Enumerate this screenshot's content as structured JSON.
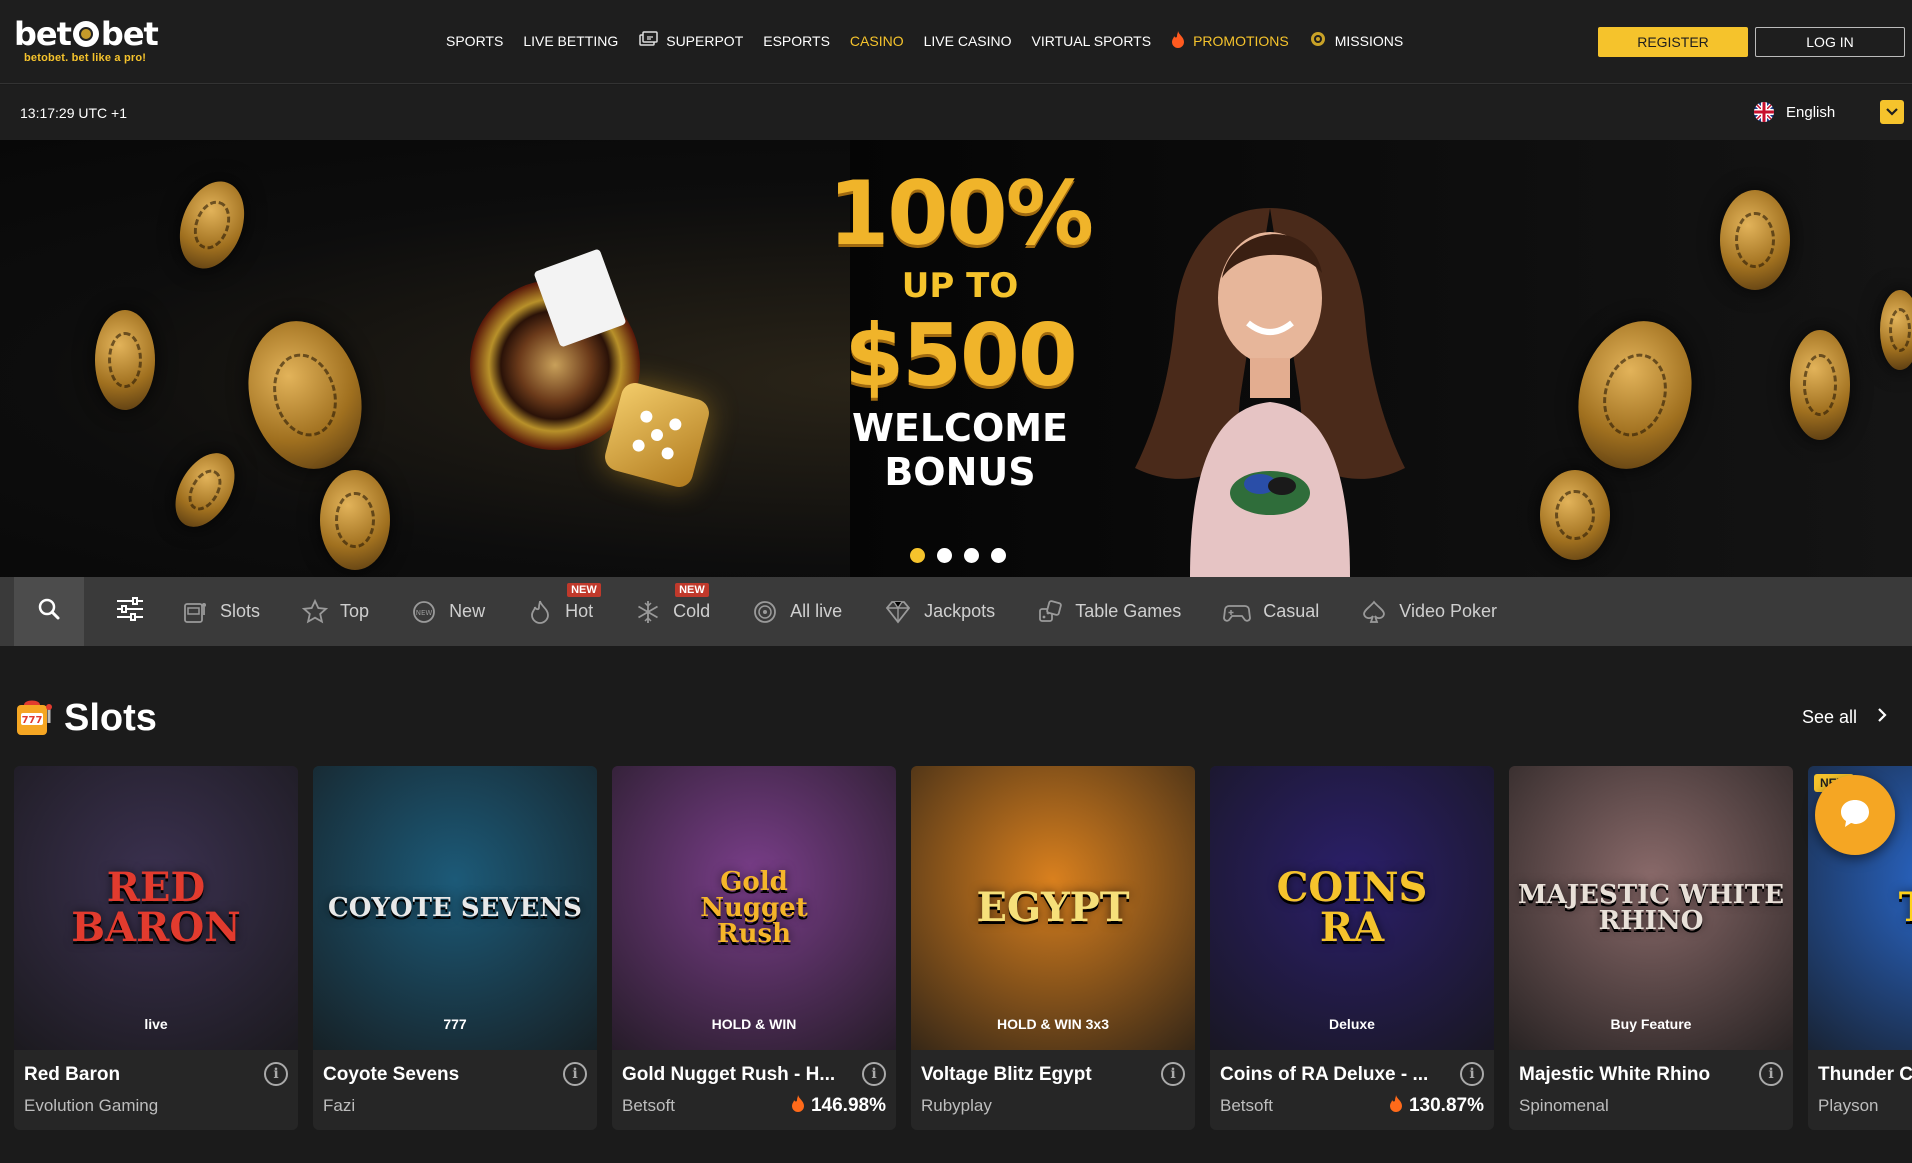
{
  "brand": {
    "logo_text_left": "bet",
    "logo_text_right": "bet",
    "tagline": "betobet. bet like a pro!"
  },
  "nav": [
    {
      "label": "SPORTS",
      "icon": ""
    },
    {
      "label": "LIVE BETTING",
      "icon": ""
    },
    {
      "label": "SUPERPOT",
      "icon": "cards-icon"
    },
    {
      "label": "ESPORTS",
      "icon": ""
    },
    {
      "label": "CASINO",
      "icon": "",
      "active": true
    },
    {
      "label": "LIVE CASINO",
      "icon": ""
    },
    {
      "label": "VIRTUAL SPORTS",
      "icon": ""
    },
    {
      "label": "PROMOTIONS",
      "icon": "flame-icon"
    },
    {
      "label": "MISSIONS",
      "icon": "target-icon"
    }
  ],
  "auth": {
    "register": "REGISTER",
    "login": "LOG IN"
  },
  "subheader": {
    "time": "13:17:29 UTC +1",
    "language": "English"
  },
  "banner": {
    "percent": "100%",
    "up_to": "UP TO",
    "amount": "$500",
    "line1": "WELCOME",
    "line2": "BONUS",
    "slide_count": 4,
    "active_slide": 1
  },
  "categories": [
    {
      "label": "Slots",
      "icon": "slot-machine-icon",
      "badge": ""
    },
    {
      "label": "Top",
      "icon": "star-icon",
      "badge": ""
    },
    {
      "label": "New",
      "icon": "new-icon",
      "badge": ""
    },
    {
      "label": "Hot",
      "icon": "flame-icon",
      "badge": "NEW"
    },
    {
      "label": "Cold",
      "icon": "snowflake-icon",
      "badge": "NEW"
    },
    {
      "label": "All live",
      "icon": "live-icon",
      "badge": ""
    },
    {
      "label": "Jackpots",
      "icon": "diamond-icon",
      "badge": ""
    },
    {
      "label": "Table Games",
      "icon": "dice-icon",
      "badge": ""
    },
    {
      "label": "Casual",
      "icon": "gamepad-icon",
      "badge": ""
    },
    {
      "label": "Video Poker",
      "icon": "spade-icon",
      "badge": ""
    }
  ],
  "section": {
    "title": "Slots",
    "see_all": "See all"
  },
  "games": [
    {
      "title": "Red Baron",
      "provider": "Evolution Gaming",
      "rtp": "",
      "art": "RED\nBARON",
      "art_sub": "live",
      "bg": "#3b3150",
      "art_color": "#e23b2e",
      "badge": ""
    },
    {
      "title": "Coyote Sevens",
      "provider": "Fazi",
      "rtp": "",
      "art": "COYOTE SEVENS",
      "art_sub": "777",
      "bg": "#1c5a78",
      "art_color": "#e8e8e8",
      "badge": ""
    },
    {
      "title": "Gold Nugget Rush - H...",
      "provider": "Betsoft",
      "rtp": "146.98%",
      "art": "Gold\nNugget\nRush",
      "art_sub": "HOLD & WIN",
      "bg": "#7a3e8a",
      "art_color": "#f5b52a",
      "badge": ""
    },
    {
      "title": "Voltage Blitz Egypt",
      "provider": "Rubyplay",
      "rtp": "",
      "art": "EGYPT",
      "art_sub": "HOLD & WIN 3x3",
      "bg": "#d9801e",
      "art_color": "#f6e07a",
      "badge": ""
    },
    {
      "title": "Coins of RA Deluxe - ...",
      "provider": "Betsoft",
      "rtp": "130.87%",
      "art": "COINS\nRA",
      "art_sub": "Deluxe",
      "bg": "#2b1f6a",
      "art_color": "#f5c32c",
      "badge": ""
    },
    {
      "title": "Majestic White Rhino",
      "provider": "Spinomenal",
      "rtp": "",
      "art": "MAJESTIC WHITE RHINO",
      "art_sub": "Buy Feature",
      "bg": "#8a6a6a",
      "art_color": "#e8e0d8",
      "badge": ""
    },
    {
      "title": "Thunder C",
      "provider": "Playson",
      "rtp": "",
      "art": "THU",
      "art_sub": "HOL",
      "bg": "#2a6ad0",
      "art_color": "#ffd21a",
      "badge": "NEW"
    }
  ]
}
